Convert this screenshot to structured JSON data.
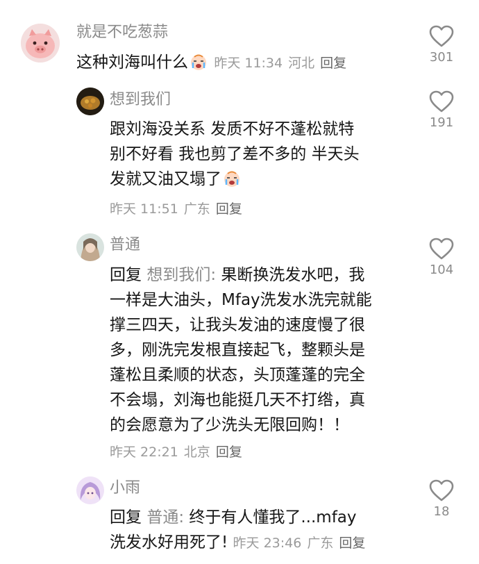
{
  "comments": [
    {
      "user": "就是不吃葱蒜",
      "lines": [
        "这种刘海叫什么"
      ],
      "time": "昨天 11:34",
      "location": "河北",
      "reply_label": "回复",
      "likes": "301"
    },
    {
      "user": "想到我们",
      "lines": [
        "跟刘海没关系 发质不好不蓬松就特",
        "别不好看 我也剪了差不多的 半天头",
        "发就又油又塌了"
      ],
      "time": "昨天 11:51",
      "location": "广东",
      "reply_label": "回复",
      "likes": "191"
    },
    {
      "user": "普通",
      "reply_prefix": "回复",
      "reply_target": "想到我们:",
      "lines": [
        "果断换洗发水吧，我",
        "一样是大油头，Mfay洗发水洗完就能",
        "撑三四天，让我头发油的速度慢了很",
        "多，刚洗完发根直接起飞，整颗头是",
        "蓬松且柔顺的状态，头顶蓬蓬的完全",
        "不会塌，刘海也能挺几天不打绺，真",
        "的会愿意为了少洗头无限回购！！"
      ],
      "time": "昨天 22:21",
      "location": "北京",
      "reply_label": "回复",
      "likes": "104"
    },
    {
      "user": "小雨",
      "reply_prefix": "回复",
      "reply_target": "普通:",
      "lines": [
        "终于有人懂我了...mfay",
        "洗发水好用死了!"
      ],
      "time": "昨天 23:46",
      "location": "广东",
      "reply_label": "回复",
      "likes": "18"
    }
  ],
  "colors": {
    "meta": "#9a9a9a",
    "text": "#161616",
    "username": "#8a8a8a"
  },
  "icons": [
    "heart-outline-icon",
    "crying-emoji-icon",
    "pig-avatar"
  ]
}
